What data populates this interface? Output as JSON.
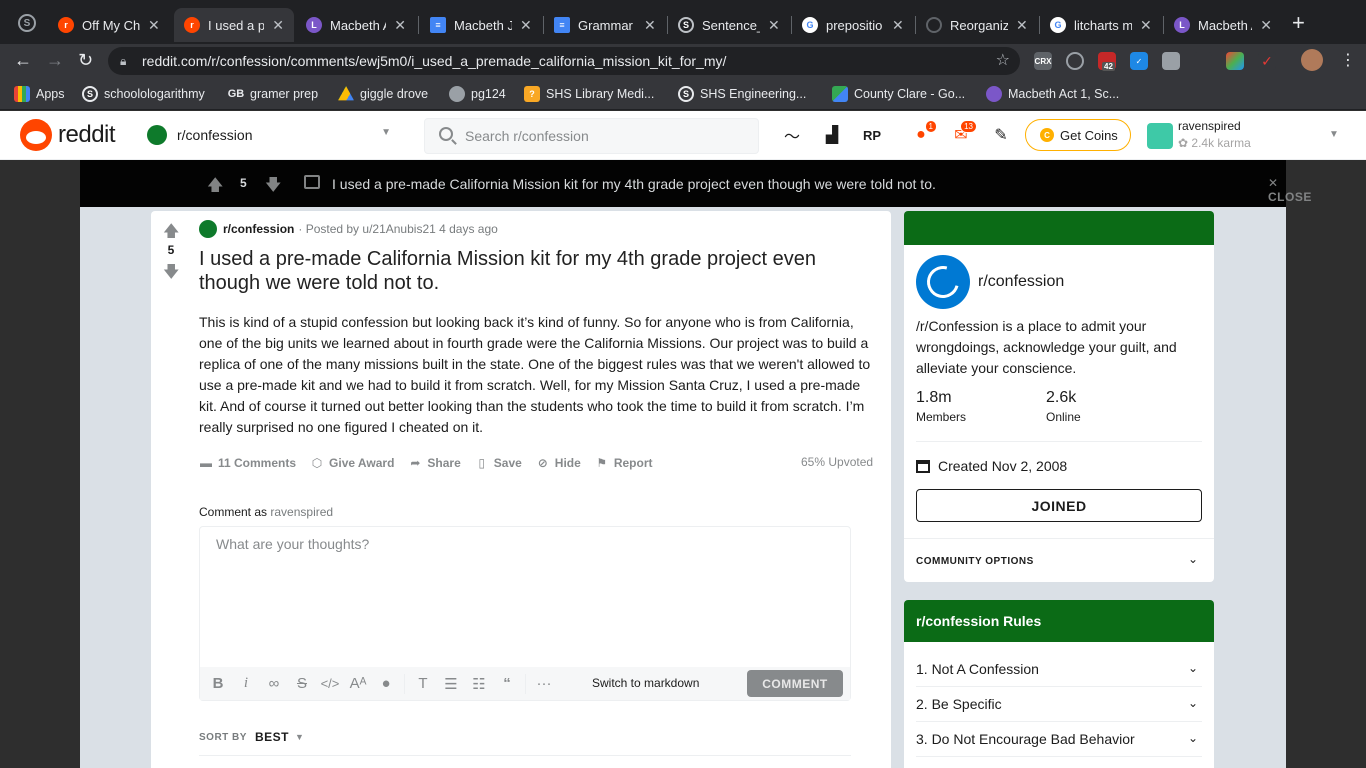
{
  "browser": {
    "tabs": [
      {
        "label": "Off My Ch",
        "color": "#ff4500",
        "glyph": "r"
      },
      {
        "label": "I used a pr",
        "color": "#ff4500",
        "glyph": "r"
      },
      {
        "label": "Macbeth A",
        "color": "#7b57c8",
        "glyph": "L"
      },
      {
        "label": "Macbeth J",
        "color": "#4285f4",
        "glyph": "≡"
      },
      {
        "label": "Grammar I",
        "color": "#4285f4",
        "glyph": "≡"
      },
      {
        "label": "Sentence_",
        "color": "#202124",
        "glyph": "S"
      },
      {
        "label": "prepositio",
        "color": "#ffffff",
        "glyph": "G"
      },
      {
        "label": "Reorganiz",
        "color": "#202124",
        "glyph": "◯"
      },
      {
        "label": "litcharts m",
        "color": "#ffffff",
        "glyph": "G"
      },
      {
        "label": "Macbeth A",
        "color": "#7b57c8",
        "glyph": "L"
      }
    ],
    "url": "reddit.com/r/confession/comments/ewj5m0/i_used_a_premade_california_mission_kit_for_my/",
    "extension_badge": "42",
    "bookmarks": [
      {
        "label": "Apps",
        "icon": "apps-grid-icon",
        "color": "#ea4335"
      },
      {
        "label": "schoolologarithmy",
        "icon": "schoology-icon",
        "color": "#35363a"
      },
      {
        "label": "gramer prep",
        "icon": "gb-icon",
        "color": "#35363a"
      },
      {
        "label": "giggle drove",
        "icon": "drive-icon",
        "color": "#fbbc04"
      },
      {
        "label": "pg124",
        "icon": "globe-icon",
        "color": "#5f6368"
      },
      {
        "label": "SHS Library Medi...",
        "icon": "library-icon",
        "color": "#f9a825"
      },
      {
        "label": "SHS Engineering...",
        "icon": "schoology-icon",
        "color": "#35363a"
      },
      {
        "label": "County Clare - Go...",
        "icon": "maps-icon",
        "color": "#34a853"
      },
      {
        "label": "Macbeth Act 1, Sc...",
        "icon": "litcharts-icon",
        "color": "#7b57c8"
      }
    ]
  },
  "reddit": {
    "wordmark": "reddit",
    "community": "r/confession",
    "search_placeholder": "Search r/confession",
    "chat_badge": "1",
    "inbox_badge": "13",
    "get_coins": "Get Coins",
    "username": "ravenspired",
    "karma": "2.4k karma"
  },
  "postbar": {
    "score": "5",
    "title": "I used a pre-made California Mission kit for my 4th grade project even though we were told not to.",
    "close": "CLOSE"
  },
  "post": {
    "score": "5",
    "subreddit": "r/confession",
    "posted_by": "· Posted by u/21Anubis21 4 days ago",
    "title": "I used a pre-made California Mission kit for my 4th grade project even though we were told not to.",
    "body": "This is kind of a stupid confession but looking back it’s kind of funny. So for anyone who is from California, one of the big units we learned about in fourth grade were the California Missions. Our project was to build a replica of one of the many missions built in the state. One of the biggest rules was that we weren't allowed to use a pre-made kit and we had to build it from scratch. Well, for my Mission Santa Cruz, I used a pre-made kit. And of course it turned out better looking than the students who took the time to build it from scratch. I’m really surprised no one figured I cheated on it.",
    "actions": {
      "comments": "11 Comments",
      "award": "Give Award",
      "share": "Share",
      "save": "Save",
      "hide": "Hide",
      "report": "Report"
    },
    "upvoted": "65% Upvoted",
    "comment_as_label": "Comment as",
    "comment_as_user": "ravenspired",
    "comment_placeholder": "What are your thoughts?",
    "switch_markdown": "Switch to markdown",
    "comment_button": "COMMENT",
    "sort_label": "SORT BY",
    "sort_value": "BEST"
  },
  "about": {
    "name": "r/confession",
    "description": "/r/Confession is a place to admit your wrongdoings, acknowledge your guilt, and alleviate your conscience.",
    "members_count": "1.8m",
    "members_label": "Members",
    "online_count": "2.6k",
    "online_label": "Online",
    "created": "Created Nov 2, 2008",
    "joined": "JOINED",
    "community_options": "COMMUNITY OPTIONS"
  },
  "rules": {
    "title": "r/confession Rules",
    "items": [
      "1. Not A Confession",
      "2. Be Specific",
      "3. Do Not Encourage Bad Behavior"
    ]
  }
}
